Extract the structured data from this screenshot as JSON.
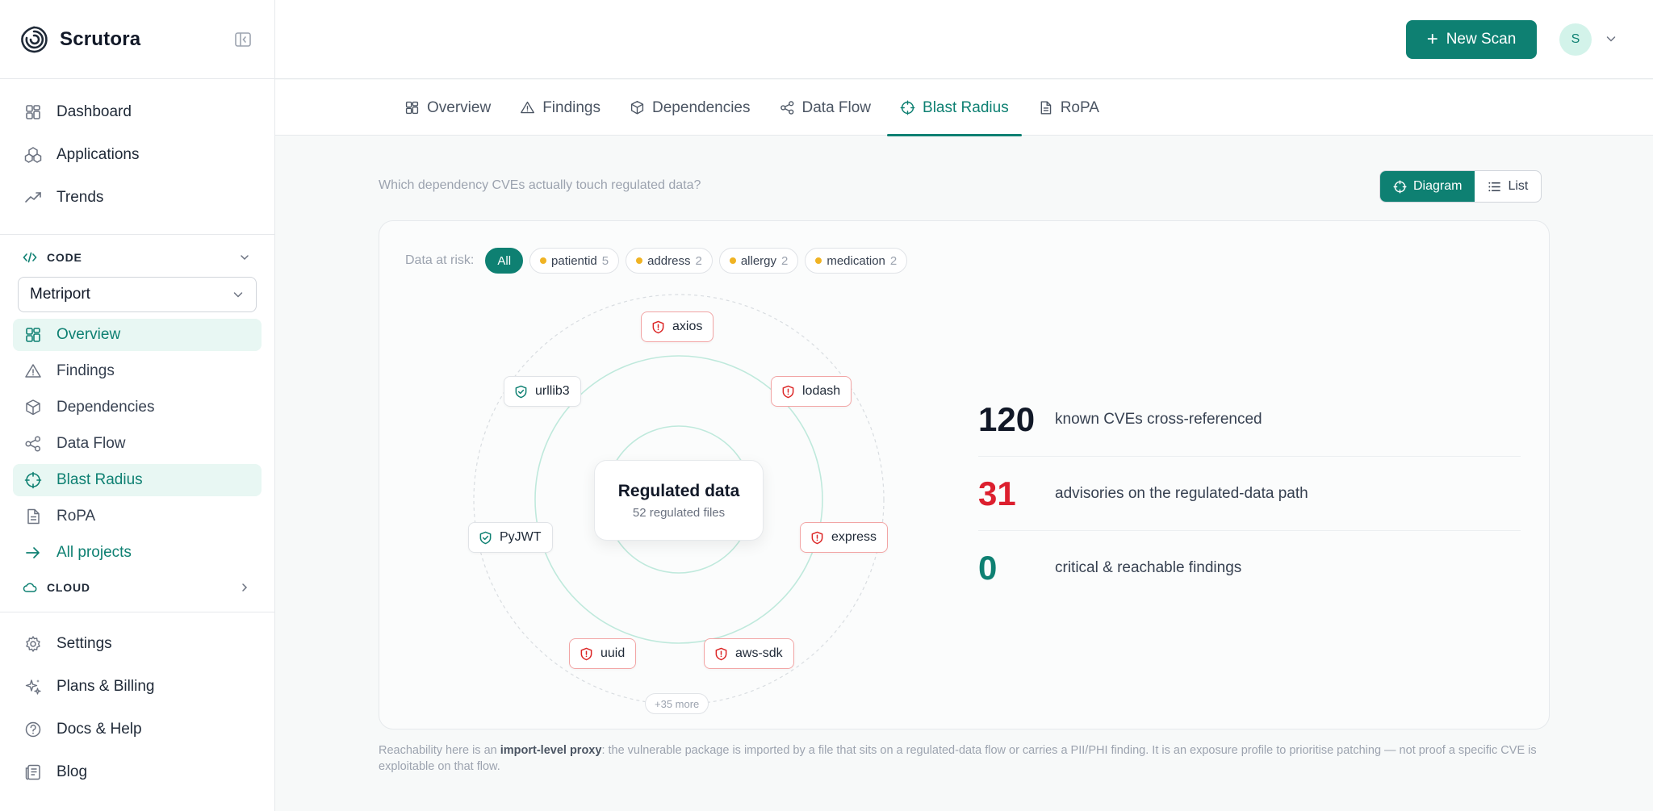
{
  "app": {
    "name": "Scrutora"
  },
  "sidebar": {
    "main": [
      {
        "label": "Dashboard",
        "icon": "dashboard-icon"
      },
      {
        "label": "Applications",
        "icon": "applications-icon"
      },
      {
        "label": "Trends",
        "icon": "trends-icon"
      }
    ],
    "code_section": "CODE",
    "project": "Metriport",
    "project_nav": [
      {
        "label": "Overview",
        "icon": "overview-icon",
        "active": true
      },
      {
        "label": "Findings",
        "icon": "findings-icon"
      },
      {
        "label": "Dependencies",
        "icon": "dependencies-icon"
      },
      {
        "label": "Data Flow",
        "icon": "data-flow-icon"
      },
      {
        "label": "Blast Radius",
        "icon": "blast-radius-icon",
        "active": true
      },
      {
        "label": "RoPA",
        "icon": "ropa-icon"
      }
    ],
    "all_projects": "All projects",
    "cloud_section": "CLOUD",
    "bottom": [
      {
        "label": "Settings",
        "icon": "settings-icon"
      },
      {
        "label": "Plans & Billing",
        "icon": "billing-icon"
      },
      {
        "label": "Docs & Help",
        "icon": "help-icon"
      },
      {
        "label": "Blog",
        "icon": "blog-icon"
      }
    ]
  },
  "topbar": {
    "new_scan": "New Scan",
    "avatar_initial": "S"
  },
  "tabs": [
    "Overview",
    "Findings",
    "Dependencies",
    "Data Flow",
    "Blast Radius",
    "RoPA"
  ],
  "active_tab": "Blast Radius",
  "main": {
    "question": "Which dependency CVEs actually touch regulated data?",
    "view": {
      "diagram": "Diagram",
      "list": "List",
      "selected": "Diagram"
    }
  },
  "filters": {
    "label": "Data at risk:",
    "all": "All",
    "chips": [
      {
        "name": "patientid",
        "count": "5"
      },
      {
        "name": "address",
        "count": "2"
      },
      {
        "name": "allergy",
        "count": "2"
      },
      {
        "name": "medication",
        "count": "2"
      }
    ]
  },
  "diagram": {
    "center_title": "Regulated data",
    "center_sub": "52 regulated files",
    "packages": {
      "axios": "axios",
      "urllib3": "urllib3",
      "lodash": "lodash",
      "pyjwt": "PyJWT",
      "express": "express",
      "uuid": "uuid",
      "aws_sdk": "aws-sdk"
    },
    "more": "+35 more",
    "colors": {
      "vulnerable": "#dc2626",
      "safe": "#0e8072"
    }
  },
  "stats": [
    {
      "value": "120",
      "text": "known CVEs cross-referenced",
      "color": "#111827"
    },
    {
      "value": "31",
      "text": "advisories on the regulated-data path",
      "color": "#dc1f2e"
    },
    {
      "value": "0",
      "text": "critical & reachable findings",
      "color": "#0e8072"
    }
  ],
  "footnote": {
    "pre": "Reachability here is an ",
    "bold": "import-level proxy",
    "post": ": the vulnerable package is imported by a file that sits on a regulated-data flow or carries a PII/PHI finding. It is an exposure profile to prioritise patching — not proof a specific CVE is exploitable on that flow."
  }
}
